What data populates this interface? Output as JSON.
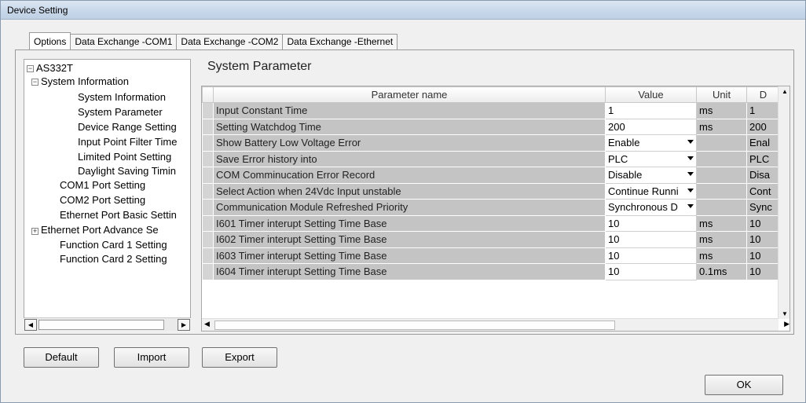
{
  "window": {
    "title": "Device Setting"
  },
  "tabs": [
    {
      "label": "Options",
      "active": true
    },
    {
      "label": "Data Exchange -COM1",
      "active": false
    },
    {
      "label": "Data Exchange -COM2",
      "active": false
    },
    {
      "label": "Data Exchange -Ethernet",
      "active": false
    }
  ],
  "tree": {
    "root": "AS332T",
    "items": [
      "System Information",
      "System Information",
      "System Parameter",
      "Device Range Setting",
      "Input Point Filter Time",
      "Limited Point Setting",
      "Daylight Saving Timin",
      "COM1 Port Setting",
      "COM2 Port Setting",
      "Ethernet Port Basic Settin",
      "Ethernet Port Advance Se",
      "Function Card 1 Setting",
      "Function Card 2 Setting"
    ],
    "expand_minus": "−",
    "expand_plus": "+"
  },
  "section_title": "System Parameter",
  "grid": {
    "headers": {
      "name": "Parameter name",
      "value": "Value",
      "unit": "Unit",
      "default": "D"
    },
    "rows": [
      {
        "name": "Input Constant Time",
        "value": "1",
        "unit": "ms",
        "default": "1",
        "dropdown": false
      },
      {
        "name": "Setting Watchdog Time",
        "value": "200",
        "unit": "ms",
        "default": "200",
        "dropdown": false
      },
      {
        "name": "Show Battery Low Voltage Error",
        "value": "Enable",
        "unit": "",
        "default": "Enal",
        "dropdown": true
      },
      {
        "name": "Save Error history into",
        "value": "PLC",
        "unit": "",
        "default": "PLC",
        "dropdown": true
      },
      {
        "name": "COM Comminucation Error Record",
        "value": "Disable",
        "unit": "",
        "default": "Disa",
        "dropdown": true
      },
      {
        "name": "Select Action when 24Vdc Input unstable",
        "value": "Continue Runni",
        "unit": "",
        "default": "Cont",
        "dropdown": true
      },
      {
        "name": "Communication Module Refreshed Priority",
        "value": "Synchronous D",
        "unit": "",
        "default": "Sync",
        "dropdown": true
      },
      {
        "name": "I601 Timer interupt Setting Time Base",
        "value": "10",
        "unit": "ms",
        "default": "10",
        "dropdown": false
      },
      {
        "name": "I602 Timer interupt Setting Time Base",
        "value": "10",
        "unit": "ms",
        "default": "10",
        "dropdown": false
      },
      {
        "name": "I603 Timer interupt Setting Time Base",
        "value": "10",
        "unit": "ms",
        "default": "10",
        "dropdown": false
      },
      {
        "name": "I604 Timer interupt Setting Time Base",
        "value": "10",
        "unit": "0.1ms",
        "default": "10",
        "dropdown": false
      }
    ]
  },
  "buttons": {
    "default": "Default",
    "import": "Import",
    "export": "Export",
    "ok": "OK"
  }
}
